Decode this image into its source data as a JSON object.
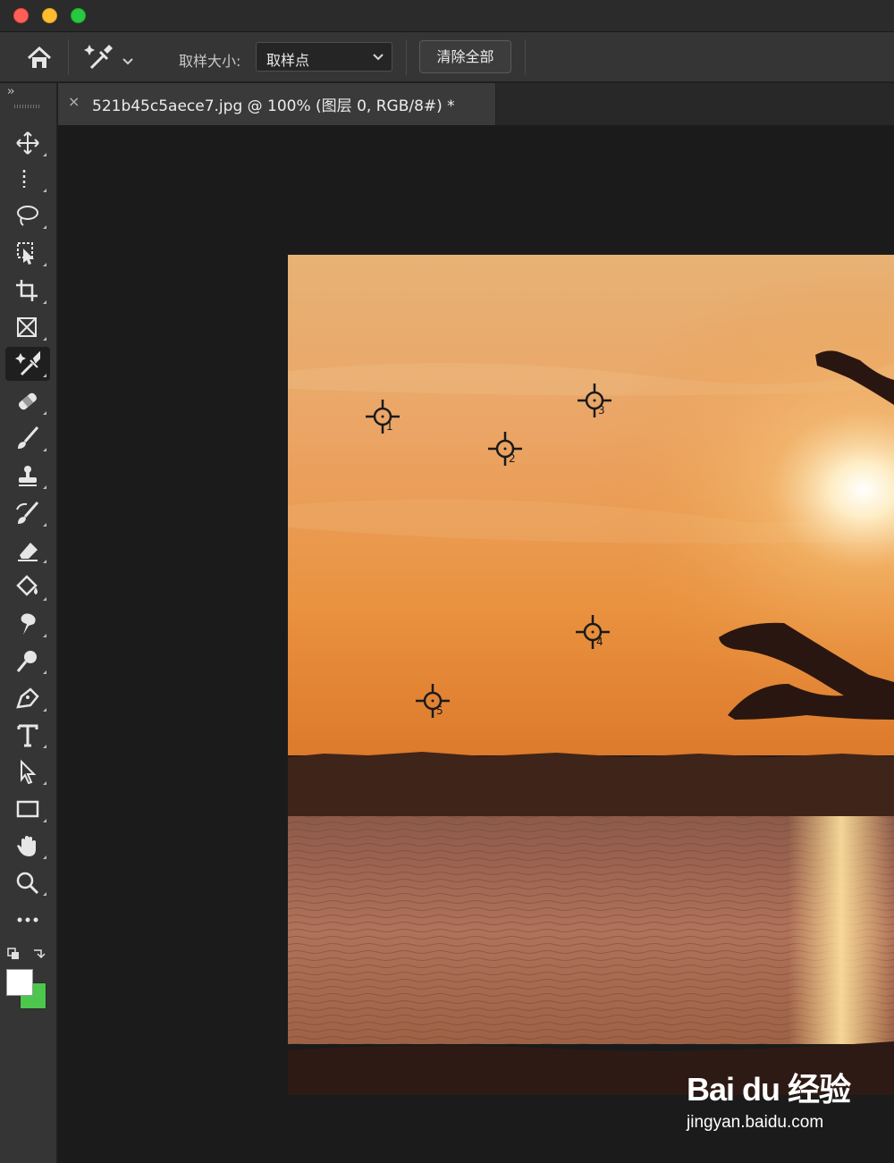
{
  "titlebar": {
    "buttons": [
      "close",
      "minimize",
      "zoom"
    ]
  },
  "options_bar": {
    "home_icon": "home-icon",
    "tool_preset_icon": "color-sampler-icon",
    "sample_size_label": "取样大小:",
    "sample_size_value": "取样点",
    "clear_all_label": "清除全部"
  },
  "tabs": [
    {
      "close": "×",
      "title": "521b45c5aece7.jpg @ 100% (图层 0, RGB/8#) *"
    }
  ],
  "toolbar": {
    "collapse": "››",
    "tools": [
      "move-tool",
      "marquee-tool",
      "lasso-tool",
      "object-selection-tool",
      "crop-tool",
      "frame-tool",
      "color-sampler-tool",
      "healing-brush-tool",
      "brush-tool",
      "clone-stamp-tool",
      "history-brush-tool",
      "eraser-tool",
      "paint-bucket-tool",
      "smudge-tool",
      "dodge-tool",
      "pen-tool",
      "type-tool",
      "path-selection-tool",
      "rectangle-tool",
      "hand-tool",
      "zoom-tool",
      "more-tools"
    ],
    "active_tool": "color-sampler-tool",
    "foreground_color": "#ffffff",
    "background_color": "#4cc64c"
  },
  "samplers": [
    {
      "label": "1"
    },
    {
      "label": "2"
    },
    {
      "label": "3"
    },
    {
      "label": "4"
    },
    {
      "label": "5"
    }
  ],
  "watermark": {
    "logo": "Bai du 经验",
    "url": "jingyan.baidu.com"
  }
}
